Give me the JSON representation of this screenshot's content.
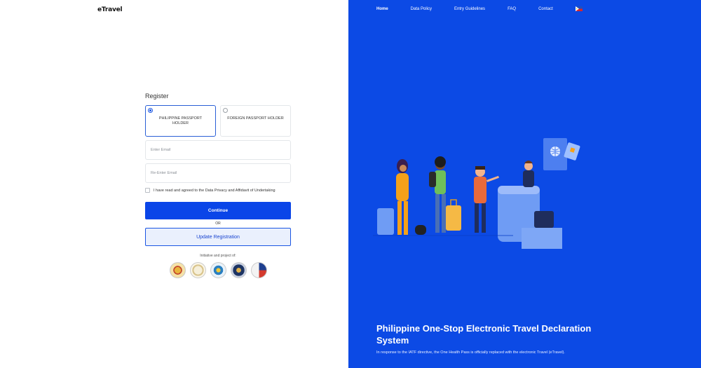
{
  "brand": {
    "logo_text": "eTravel"
  },
  "register": {
    "title": "Register",
    "holder_options": [
      {
        "label": "PHILIPPINE PASSPORT HOLDER",
        "selected": true
      },
      {
        "label": "FOREIGN PASSPORT HOLDER",
        "selected": false
      }
    ],
    "email_placeholder": "Enter Email",
    "reenter_email_placeholder": "Re-Enter Email",
    "agreement_text": "I have read and agreed to the Data Privacy and Affidavit of Undertaking",
    "continue_label": "Continue",
    "or_text": "OR",
    "update_label": "Update Registration",
    "initiative_text": "Initiative and project of:"
  },
  "nav": {
    "items": [
      "Home",
      "Data Policy",
      "Entry Guidelines",
      "FAQ",
      "Contact"
    ],
    "active": "Home",
    "language_icon": "philippine-flag-icon"
  },
  "hero": {
    "title": "Philippine One-Stop Electronic Travel Declaration System",
    "subtitle": "In response to the IATF directive, the One Health Pass is officially replaced with the electronic Travel (eTravel)."
  },
  "colors": {
    "primary_blue": "#0a45e8",
    "panel_blue": "#0c4ae5",
    "secondary_bg": "#eaf0fd"
  }
}
